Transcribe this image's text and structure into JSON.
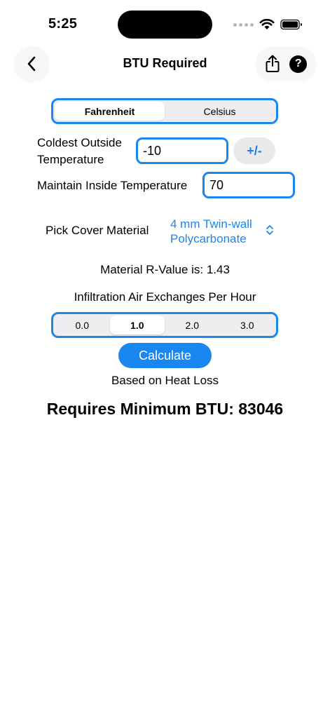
{
  "status": {
    "time": "5:25"
  },
  "nav": {
    "title": "BTU Required"
  },
  "units": {
    "options": [
      "Fahrenheit",
      "Celsius"
    ],
    "selected": "Fahrenheit"
  },
  "coldest": {
    "label_line1": "Coldest Outside",
    "label_line2": "Temperature",
    "value": "-10",
    "sign_button": "+/-"
  },
  "inside": {
    "label": "Maintain Inside Temperature",
    "value": "70"
  },
  "material": {
    "label": "Pick Cover Material",
    "value_line1": "4 mm Twin-wall",
    "value_line2": "Polycarbonate",
    "r_value_text": "Material R-Value is: 1.43"
  },
  "infiltration": {
    "label": "Infiltration Air Exchanges Per Hour",
    "options": [
      "0.0",
      "1.0",
      "2.0",
      "3.0"
    ],
    "selected": "1.0"
  },
  "calculate": {
    "label": "Calculate"
  },
  "basis": "Based on Heat Loss",
  "result": "Requires Minimum BTU: 83046",
  "colors": {
    "accent": "#1a86f0",
    "field_border": "#1a86f0",
    "button_bg": "#e9e9eb"
  }
}
